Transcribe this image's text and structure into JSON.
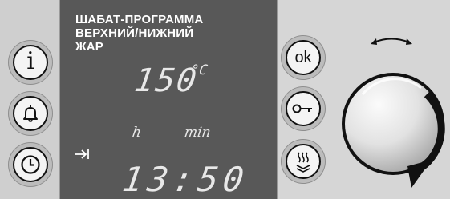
{
  "display": {
    "title_lines": [
      "ШАБАТ-ПРОГРАММА",
      "ВЕРХНИЙ/НИЖНИЙ",
      "ЖАР"
    ],
    "temperature_value": "150",
    "temperature_unit": "°C",
    "label_hours": "h",
    "label_minutes": "min",
    "time_value": "13:50"
  },
  "buttons": {
    "ok_label": "ok"
  },
  "icons": {
    "left": [
      "info-icon",
      "bell-icon",
      "clock-icon"
    ],
    "right": [
      "key-icon",
      "heat-icon"
    ],
    "display": [
      "arrow-to-bar-icon"
    ],
    "knob": [
      "rotate-arrow-icon",
      "dial-knob"
    ]
  },
  "colors": {
    "display_bg": "#585858",
    "frame_bg": "#d6d6d6",
    "text_on_display": "#ffffff"
  }
}
